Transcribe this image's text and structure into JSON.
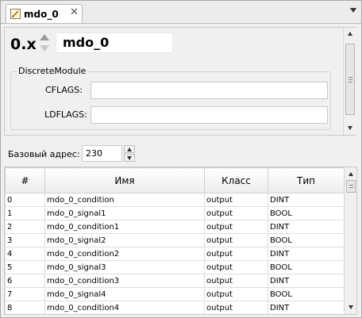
{
  "tab": {
    "title": "mdo_0",
    "icon": "edit-icon",
    "close": "✕"
  },
  "header": {
    "version": "0.x",
    "name": "mdo_0"
  },
  "group": {
    "title": "DiscreteModule",
    "cflags_label": "CFLAGS:",
    "cflags_value": "",
    "ldflags_label": "LDFLAGS:",
    "ldflags_value": ""
  },
  "base_address": {
    "label": "Базовый адрес:",
    "value": "230"
  },
  "table": {
    "columns": [
      "#",
      "Имя",
      "Класс",
      "Тип"
    ],
    "rows": [
      [
        "0",
        "mdo_0_condition",
        "output",
        "DINT"
      ],
      [
        "1",
        "mdo_0_signal1",
        "output",
        "BOOL"
      ],
      [
        "2",
        "mdo_0_condition1",
        "output",
        "DINT"
      ],
      [
        "3",
        "mdo_0_signal2",
        "output",
        "BOOL"
      ],
      [
        "4",
        "mdo_0_condition2",
        "output",
        "DINT"
      ],
      [
        "5",
        "mdo_0_signal3",
        "output",
        "BOOL"
      ],
      [
        "6",
        "mdo_0_condition3",
        "output",
        "DINT"
      ],
      [
        "7",
        "mdo_0_signal4",
        "output",
        "BOOL"
      ],
      [
        "8",
        "mdo_0_condition4",
        "output",
        "DINT"
      ]
    ]
  }
}
